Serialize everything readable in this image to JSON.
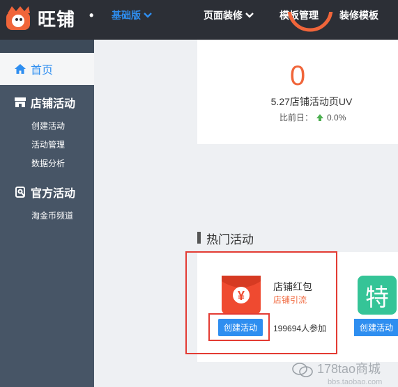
{
  "header": {
    "brand": "旺铺",
    "brand_dot": "•",
    "edition": "基础版",
    "nav": [
      "页面装修",
      "模板管理",
      "装修模板"
    ]
  },
  "sidebar": {
    "home": "首页",
    "groups": [
      {
        "label": "店铺活动",
        "items": [
          "创建活动",
          "活动管理",
          "数据分析"
        ]
      },
      {
        "label": "官方活动",
        "items": [
          "淘金币频道"
        ]
      }
    ]
  },
  "stats": {
    "uv_value": "0",
    "uv_label": "5.27店铺活动页UV",
    "compare_label": "比前日：",
    "compare_value": "0.0%"
  },
  "hot": {
    "title": "热门活动",
    "cards": [
      {
        "name": "店铺红包",
        "tag": "店铺引流",
        "button": "创建活动",
        "participants": "199694人参加",
        "glyph": "¥"
      },
      {
        "glyph": "特",
        "button": "创建活动"
      }
    ]
  },
  "watermark": {
    "text": "178tao商城",
    "sub": "bbs.taobao.com"
  },
  "colors": {
    "topbar": "#2c2f36",
    "sidebar": "#475566",
    "accent_blue": "#2e8ef0",
    "accent_orange": "#f0653a",
    "highlight_red": "#e33b33",
    "hongbao_red": "#ef4a30",
    "te_green": "#35c497"
  }
}
